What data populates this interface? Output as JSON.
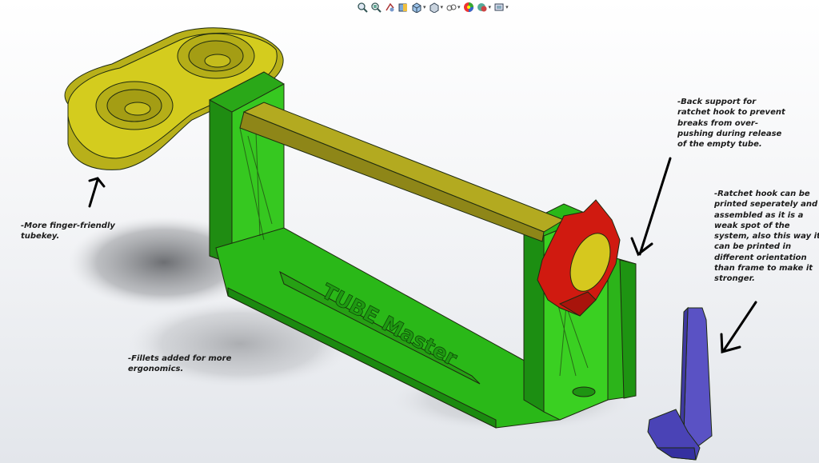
{
  "toolbar": {
    "icons": [
      {
        "name": "zoom-to-fit-icon",
        "caret": false
      },
      {
        "name": "zoom-to-area-icon",
        "caret": false
      },
      {
        "name": "previous-view-icon",
        "caret": false
      },
      {
        "name": "section-view-icon",
        "caret": false
      },
      {
        "name": "view-orientation-icon",
        "caret": true
      },
      {
        "name": "display-style-icon",
        "caret": true
      },
      {
        "name": "hide-show-items-icon",
        "caret": true
      },
      {
        "name": "edit-appearance-icon",
        "caret": false
      },
      {
        "name": "apply-scene-icon",
        "caret": true
      },
      {
        "name": "view-settings-icon",
        "caret": true
      }
    ]
  },
  "model": {
    "embossed_text": "TUBE Master",
    "colors": {
      "tubekey": "#d4cc1e",
      "frame": "#2fc21a",
      "rod": "#a89f20",
      "ratchet_gear": "#d01a10",
      "ratchet_hub": "#d6c81e",
      "ratchet_hook": "#5a52c4",
      "edges": "#1e2a10",
      "shadow": "#6b6d70"
    }
  },
  "annotations": {
    "tubekey": "-More finger-friendly\ntubekey.",
    "fillets": "-Fillets added for more\nergonomics.",
    "back_support": "-Back support for\nratchet hook to prevent\nbreaks from over-\npushing during release\nof the empty tube.",
    "ratchet_hook": "-Ratchet hook can be\nprinted seperately and\nassembled as it is a\nweak spot of the\nsystem, also this way it\ncan be printed in\ndifferent orientation\nthan frame to make it\nstronger."
  }
}
